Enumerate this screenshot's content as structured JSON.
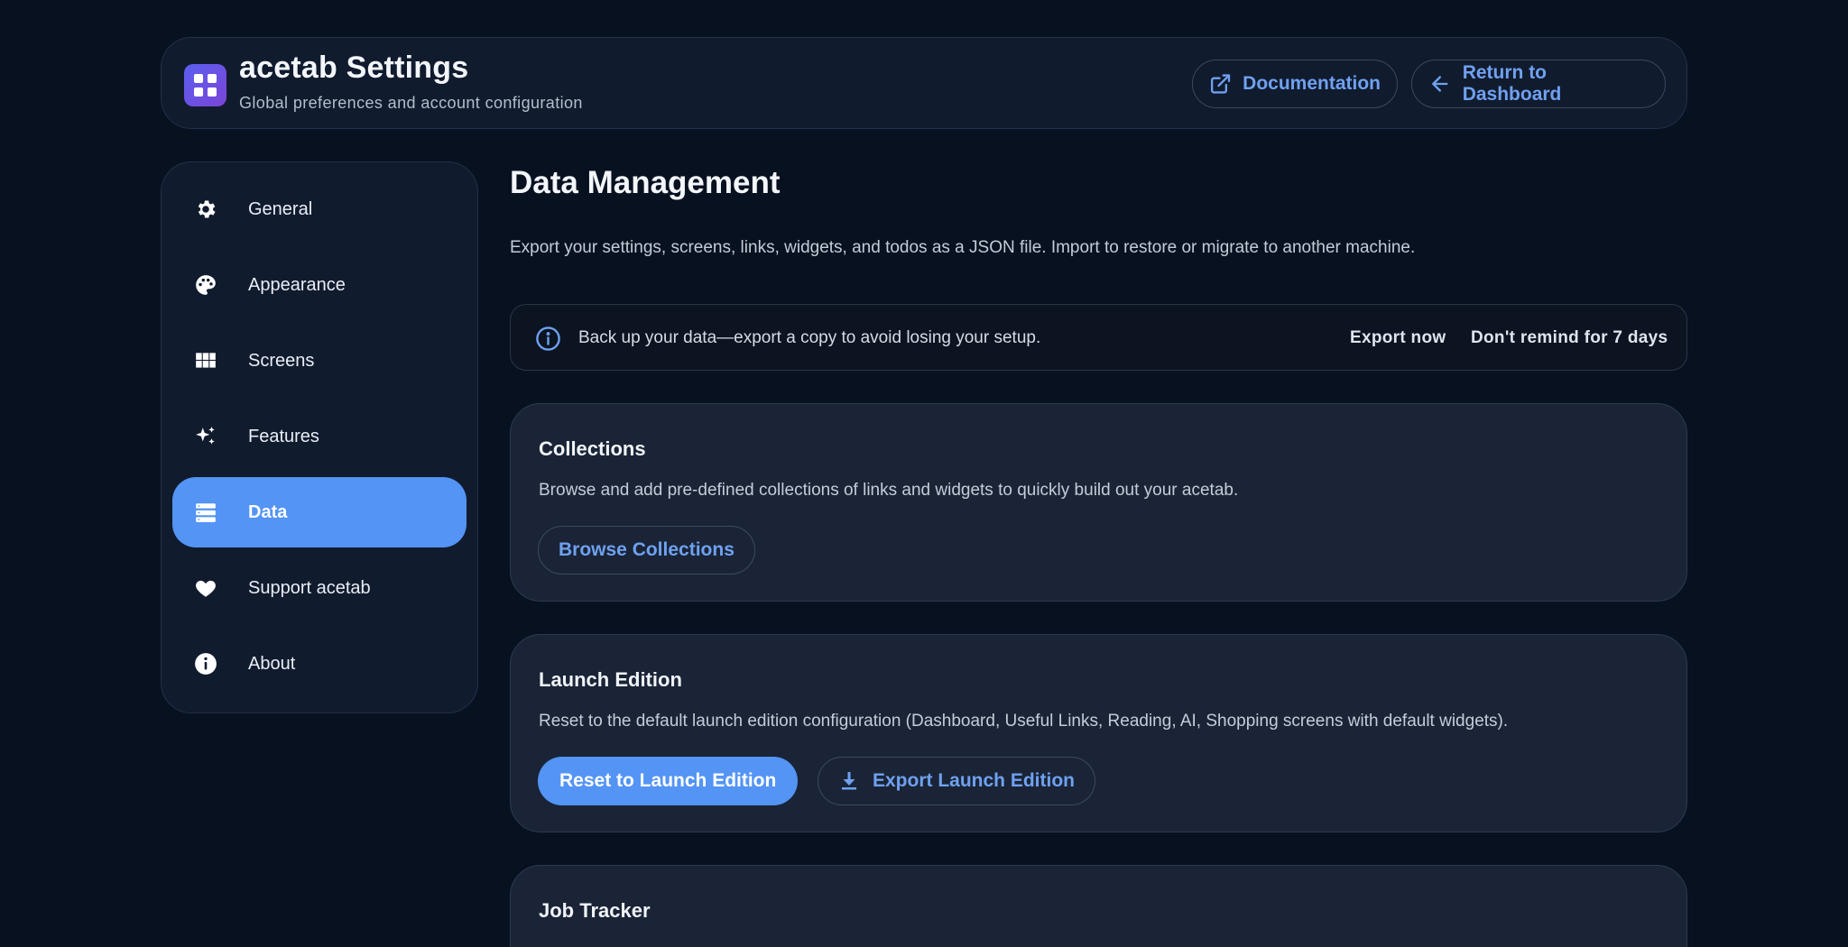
{
  "header": {
    "title": "acetab Settings",
    "subtitle": "Global preferences and account configuration",
    "doc_label": "Documentation",
    "return_label": "Return to Dashboard"
  },
  "sidebar": {
    "items": [
      {
        "label": "General",
        "icon": "gear-icon"
      },
      {
        "label": "Appearance",
        "icon": "palette-icon"
      },
      {
        "label": "Screens",
        "icon": "grid-icon"
      },
      {
        "label": "Features",
        "icon": "sparkles-icon"
      },
      {
        "label": "Data",
        "icon": "database-icon",
        "active": true
      },
      {
        "label": "Support acetab",
        "icon": "heart-icon"
      },
      {
        "label": "About",
        "icon": "info-icon"
      }
    ]
  },
  "main": {
    "title": "Data Management",
    "description": "Export your settings, screens, links, widgets, and todos as a JSON file. Import to restore or migrate to another machine.",
    "banner": {
      "text": "Back up your data—export a copy to avoid losing your setup.",
      "export_label": "Export now",
      "dismiss_label": "Don't remind for 7 days"
    },
    "cards": [
      {
        "title": "Collections",
        "description": "Browse and add pre-defined collections of links and widgets to quickly build out your acetab.",
        "button": "Browse Collections"
      },
      {
        "title": "Launch Edition",
        "description": "Reset to the default launch edition configuration (Dashboard, Useful Links, Reading, AI, Shopping screens with default widgets).",
        "primary_button": "Reset to Launch Edition",
        "secondary_button": "Export Launch Edition"
      },
      {
        "title": "Job Tracker"
      }
    ]
  },
  "colors": {
    "background": "#081120",
    "accent": "#5394f4",
    "link": "#6fa1f0"
  }
}
